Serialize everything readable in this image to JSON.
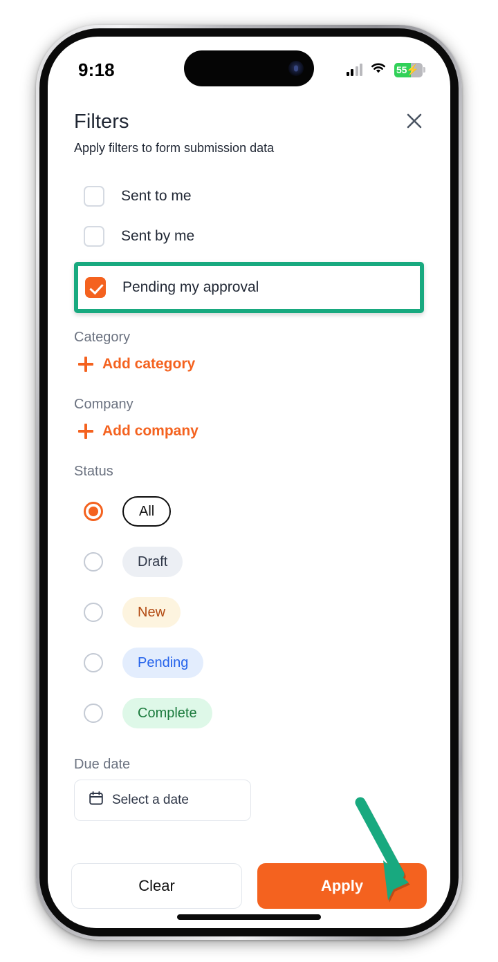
{
  "status_bar": {
    "time": "9:18",
    "cellular_icon": "cellular-bars-icon",
    "wifi_icon": "wifi-icon",
    "battery_percent": "55",
    "battery_charging_icon": "lightning-bolt-icon"
  },
  "header": {
    "title": "Filters",
    "subtitle": "Apply filters to form submission data",
    "close_icon": "close-icon"
  },
  "checkboxes": [
    {
      "label": "Sent to me",
      "checked": false
    },
    {
      "label": "Sent by me",
      "checked": false
    },
    {
      "label": "Pending my approval",
      "checked": true,
      "highlighted": true
    }
  ],
  "category": {
    "label": "Category",
    "add_label": "Add category",
    "add_icon": "plus-icon"
  },
  "company": {
    "label": "Company",
    "add_label": "Add company",
    "add_icon": "plus-icon"
  },
  "status": {
    "label": "Status",
    "options": [
      {
        "label": "All",
        "selected": true
      },
      {
        "label": "Draft",
        "selected": false
      },
      {
        "label": "New",
        "selected": false
      },
      {
        "label": "Pending",
        "selected": false
      },
      {
        "label": "Complete",
        "selected": false
      }
    ]
  },
  "due_date": {
    "label": "Due date",
    "field_icon": "calendar-icon",
    "field_value": "Select a date"
  },
  "actions": {
    "clear_label": "Clear",
    "apply_label": "Apply"
  },
  "annotation": {
    "arrow_icon": "arrow-pointing-to-apply",
    "arrow_color": "#18a97f",
    "highlight_color": "#18a97f"
  },
  "colors": {
    "accent_orange": "#f4621f",
    "annotation_green": "#18a97f",
    "battery_green": "#31d158",
    "text_dark": "#1f2633",
    "text_muted": "#6b7280"
  }
}
